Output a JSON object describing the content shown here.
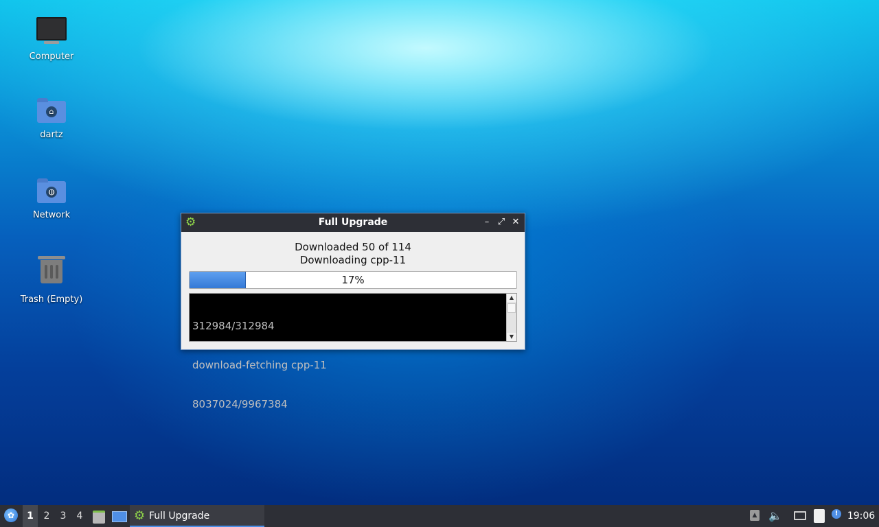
{
  "desktop": {
    "icons": [
      {
        "label": "Computer",
        "icon": "computer-icon"
      },
      {
        "label": "dartz",
        "icon": "home-folder-icon"
      },
      {
        "label": "Network",
        "icon": "network-folder-icon"
      },
      {
        "label": "Trash (Empty)",
        "icon": "trash-icon"
      }
    ]
  },
  "window": {
    "title": "Full Upgrade",
    "app_icon": "gear-icon",
    "controls": {
      "minimize": "minimize-icon",
      "maximize": "maximize-icon",
      "close": "close-icon"
    },
    "status_line1": "Downloaded 50 of 114",
    "status_line2": "Downloading cpp-11",
    "progress": {
      "percent": 17,
      "label": "17%"
    },
    "log_lines": [
      "312984/312984",
      "download-fetching cpp-11",
      "8037024/9967384"
    ]
  },
  "taskbar": {
    "start_icon": "lxqt-menu-icon",
    "workspaces": [
      "1",
      "2",
      "3",
      "4"
    ],
    "active_workspace": "1",
    "quicklaunch": [
      "file-manager-icon",
      "show-desktop-icon"
    ],
    "tasks": [
      {
        "label": "Full Upgrade",
        "icon": "gear-icon"
      }
    ],
    "tray": [
      "tray-expand-icon",
      "volume-icon",
      "network-icon",
      "clipboard-icon",
      "update-notifier-icon"
    ],
    "clock": "19:06"
  },
  "colors": {
    "taskbar_bg": "#2d2f36",
    "titlebar_bg": "#2d2f36",
    "progress_fill": "#3479d6",
    "log_bg": "#000000",
    "log_text": "#bfbfbf"
  }
}
